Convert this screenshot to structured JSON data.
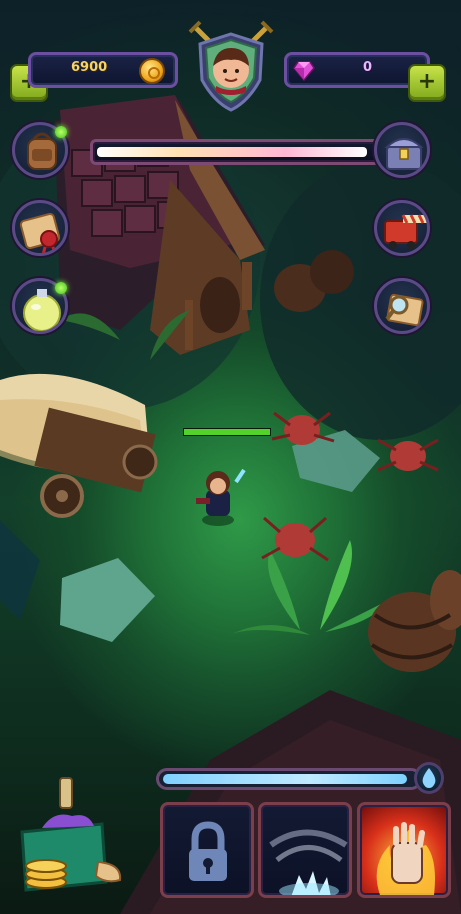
{
  "hud": {
    "coins": "6900",
    "gems": "0",
    "coin_icon": "gold-coin-icon",
    "gem_icon": "pink-gem-icon",
    "add_coins_icon": "plus-icon",
    "add_gems_icon": "plus-icon"
  },
  "player": {
    "avatar_icon": "hero-portrait-icon"
  },
  "left_menu": [
    {
      "id": "backpack",
      "icon": "backpack-icon",
      "has_notification": true
    },
    {
      "id": "quests",
      "icon": "scroll-seal-icon",
      "has_notification": false
    },
    {
      "id": "potion",
      "icon": "potion-flask-icon",
      "has_notification": true
    }
  ],
  "right_menu": [
    {
      "id": "chest",
      "icon": "treasure-chest-icon"
    },
    {
      "id": "shop",
      "icon": "shop-truck-icon"
    },
    {
      "id": "map",
      "icon": "map-magnifier-icon"
    }
  ],
  "progress": {
    "top_bar_fraction": 0.98,
    "mana_fraction": 0.97,
    "hero_health_fraction": 1.0
  },
  "abilities": [
    {
      "id": "slot-1",
      "icon": "padlock-icon",
      "locked": true
    },
    {
      "id": "slot-2",
      "icon": "slash-strike-icon",
      "locked": false
    },
    {
      "id": "slot-3",
      "icon": "fire-hand-icon",
      "locked": false
    }
  ],
  "inventory_icon": "loot-bag-icon",
  "colors": {
    "accent_purple": "#6c4fa1",
    "plus_green": "#9cc62e",
    "coin_gold": "#f3d36a",
    "health_green": "#52d22a"
  }
}
